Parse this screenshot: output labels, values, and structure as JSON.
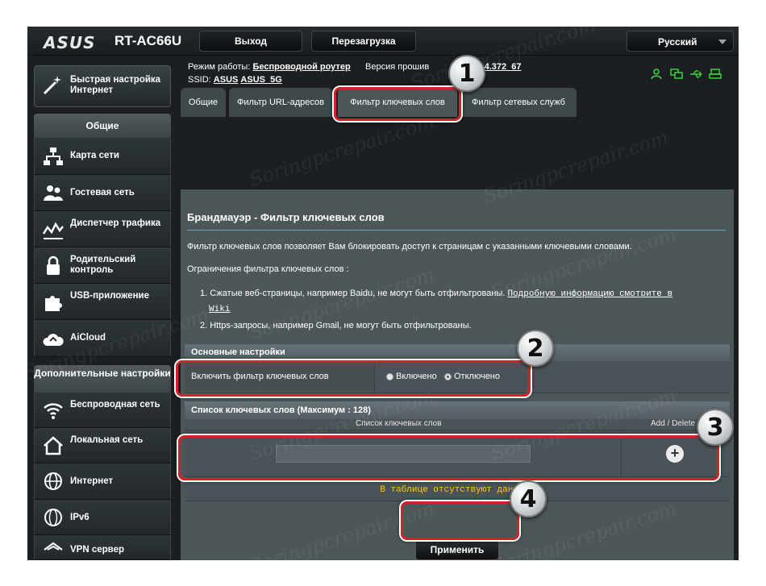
{
  "header": {
    "brand": "ASUS",
    "model": "RT-AC66U",
    "logout_label": "Выход",
    "reboot_label": "Перезагрузка",
    "language": "Русский"
  },
  "info": {
    "mode_label": "Режим работы:",
    "mode_value": "Беспроводной роутер",
    "firmware_label": "Версия прошив",
    "firmware_value": ".0.4.372_67",
    "ssid_label": "SSID:",
    "ssid_1": "ASUS",
    "ssid_2": "ASUS_5G"
  },
  "sidebar": {
    "quick_setup": "Быстрая настройка Интернет",
    "general_header": "Общие",
    "general_items": [
      {
        "label": "Карта сети"
      },
      {
        "label": "Гостевая сеть"
      },
      {
        "label": "Диспетчер трафика"
      },
      {
        "label": "Родительский контроль"
      },
      {
        "label": "USB-приложение"
      },
      {
        "label": "AiCloud"
      }
    ],
    "advanced_header": "Дополнительные настройки",
    "advanced_items": [
      {
        "label": "Беспроводная сеть"
      },
      {
        "label": "Локальная сеть"
      },
      {
        "label": "Интернет"
      },
      {
        "label": "IPv6"
      },
      {
        "label": "VPN сервер"
      }
    ]
  },
  "tabs": [
    {
      "label": "Общие"
    },
    {
      "label": "Фильтр URL-адресов"
    },
    {
      "label": "Фильтр ключевых слов"
    },
    {
      "label": "Фильтр сетевых служб"
    }
  ],
  "content": {
    "title": "Брандмауэр - Фильтр ключевых слов",
    "description": "Фильтр ключевых слов позволяет Вам блокировать доступ к страницам с указанными ключевыми словами.",
    "limits_heading": "Ограничения фильтра ключевых слов :",
    "limit_1_text": "1. Сжатые веб-страницы, например Baidu, не могут быть отфильтрованы.",
    "limit_1_link": "Подробную информацию смотрите в",
    "limit_1_link_2": "Wiki",
    "limit_2_text": "2. Https-запросы, например Gmail, не могут быть отфильтрованы.",
    "basic_settings": "Основные настройки",
    "enable_label": "Включить фильтр ключевых слов",
    "radio_on": "Включено",
    "radio_off": "Отключено",
    "list_title": "Список ключевых слов (Максимум : 128)",
    "col_keywords": "Список ключевых слов",
    "col_actions": "Add / Delete",
    "empty_text": "В таблице отсутствуют данные.",
    "apply_label": "Применить",
    "keyword_value": ""
  },
  "badges": [
    "1",
    "2",
    "3",
    "4"
  ],
  "watermark": "Soringpcrepair.com",
  "colors": {
    "highlight": "#d8202a",
    "empty_text": "#ffcc00",
    "status_icon": "#3ecf3e"
  }
}
